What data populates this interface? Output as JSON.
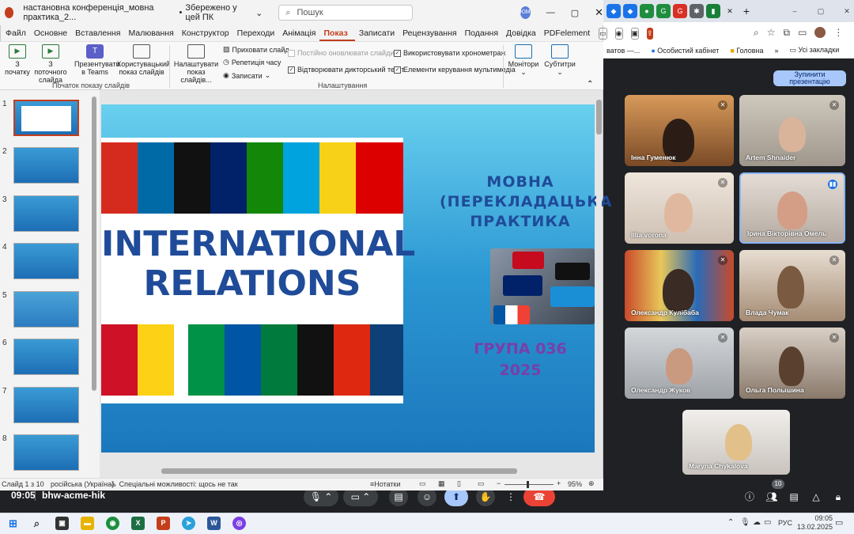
{
  "powerpoint": {
    "title": "настановна конференція_мовна практика_2...",
    "save_status": "Збережено у цей ПК",
    "search_placeholder": "Пошук",
    "user_initials": "ЮМ",
    "menu": [
      "Файл",
      "Основне",
      "Вставлення",
      "Малювання",
      "Конструктор",
      "Переходи",
      "Анімація",
      "Показ слайді",
      "Записати",
      "Рецензування",
      "Подання",
      "Довідка",
      "PDFelement"
    ],
    "active_menu_index": 7,
    "ribbon": {
      "from_start": "З початку",
      "from_current": "З поточного слайда",
      "present_teams": "Презентувати в Teams",
      "custom_show": "Користувацький показ слайдів",
      "group_start": "Початок показу слайдів",
      "setup_show": "Налаштувати показ слайдів...",
      "hide_slide": "Приховати слайд",
      "rehearse": "Репетиція часу",
      "record": "Записати",
      "always_update": "Постійно оновлювати слайди",
      "play_narration": "Відтворювати дикторський текст",
      "use_timings": "Використовувати хронометраж",
      "media_controls": "Елементи керування мультимедіа",
      "group_setup": "Налаштування",
      "monitors": "Монітори",
      "subtitles": "Субтитри"
    },
    "thumbnails": [
      "1",
      "2",
      "3",
      "4",
      "5",
      "6",
      "7",
      "8"
    ],
    "slide": {
      "left_title_line1": "INTERNATIONAL",
      "left_title_line2": "RELATIONS",
      "right_title_line1": "МОВНА",
      "right_title_line2": "(ПЕРЕКЛАДАЦЬКА",
      "right_title_line3": "ПРАКТИКА",
      "group_line1": "ГРУПА 036",
      "group_line2": "2025"
    },
    "status": {
      "slide_counter": "Слайд 1 з 10",
      "language": "російська (Україна)",
      "accessibility": "Спеціальні можливості: щось не так",
      "notes": "Нотатки",
      "zoom": "95%"
    }
  },
  "browser": {
    "bookmark1": "ватов —...",
    "bookmark2": "Особистий кабінет",
    "bookmark3": "Головна",
    "bookmark_all": "Усі закладки"
  },
  "meet": {
    "stop_presenting": "Зупинити презентацію",
    "time": "09:05",
    "meeting_code": "bhw-acme-hik",
    "participant_count": "10",
    "participants": [
      {
        "name": "Інна Гуменюк"
      },
      {
        "name": "Artem Shnaider"
      },
      {
        "name": "Illia vorona"
      },
      {
        "name": "Ірина Вікторівна Омель"
      },
      {
        "name": "Олександр Кулібаба"
      },
      {
        "name": "Влада Чумак"
      },
      {
        "name": "Олександр Жуков"
      },
      {
        "name": "Ольга Полышина"
      },
      {
        "name": "Maryna Chykalova"
      }
    ]
  },
  "taskbar": {
    "time": "09:05",
    "date": "13.02.2025",
    "lang": "РУС"
  }
}
